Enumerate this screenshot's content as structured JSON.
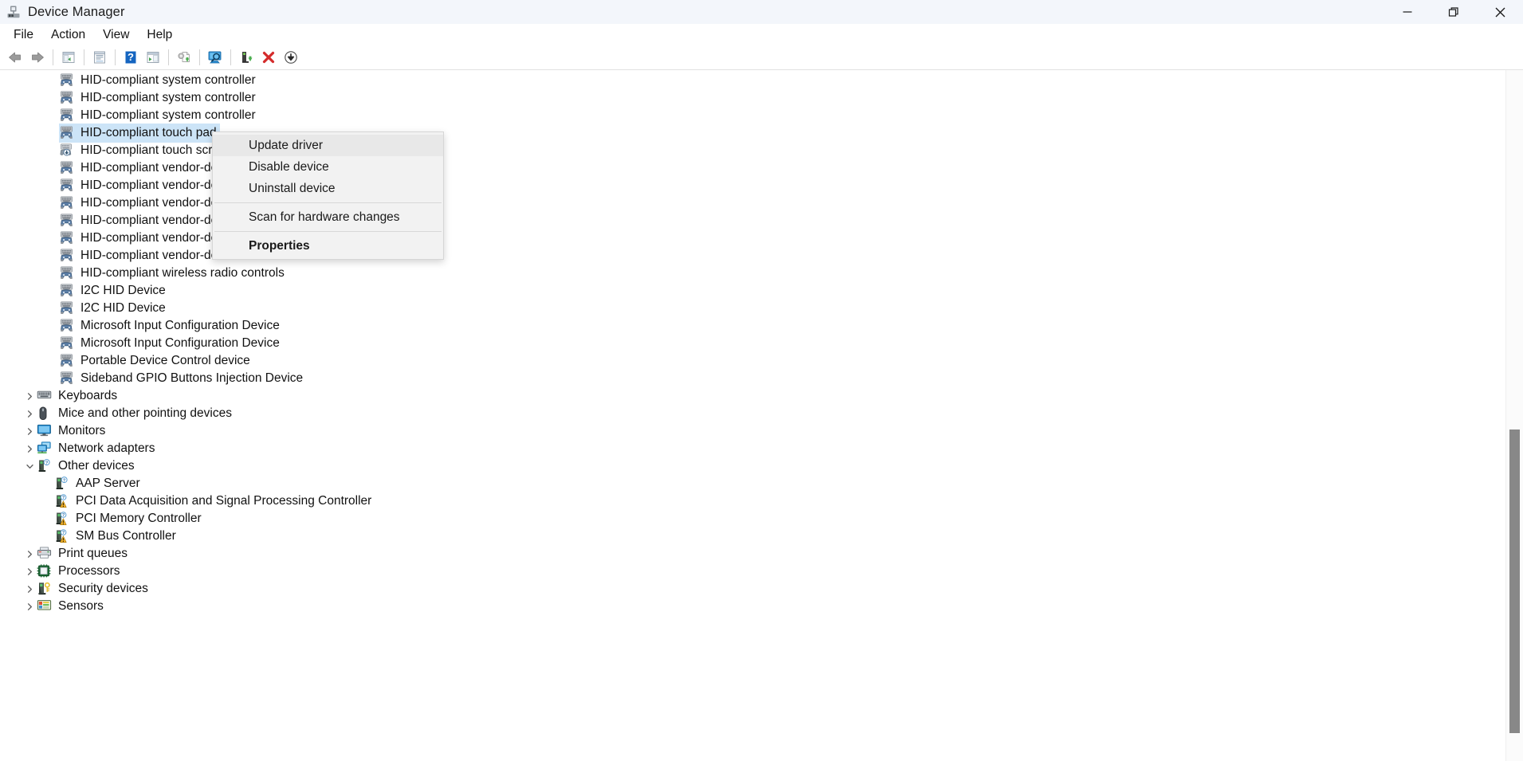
{
  "window": {
    "title": "Device Manager",
    "icon": "device-manager-icon",
    "controls": [
      {
        "name": "minimize",
        "glyph": "minimize-icon"
      },
      {
        "name": "maximize",
        "glyph": "restore-icon"
      },
      {
        "name": "close",
        "glyph": "close-icon"
      }
    ]
  },
  "menubar": {
    "items": [
      {
        "label": "File"
      },
      {
        "label": "Action"
      },
      {
        "label": "View"
      },
      {
        "label": "Help"
      }
    ]
  },
  "toolbar": {
    "buttons": [
      {
        "name": "back-button",
        "icon": "back-arrow-icon"
      },
      {
        "name": "forward-button",
        "icon": "forward-arrow-icon"
      },
      {
        "name": "show-hide-console-tree-button",
        "icon": "console-tree-icon"
      },
      {
        "name": "properties-button",
        "icon": "properties-window-icon"
      },
      {
        "name": "help-button",
        "icon": "help-question-icon"
      },
      {
        "name": "show-hide-action-pane-button",
        "icon": "action-pane-icon"
      },
      {
        "name": "update-driver-button",
        "icon": "update-driver-gear-icon"
      },
      {
        "name": "scan-for-hardware-changes-button",
        "icon": "scan-hardware-monitor-icon"
      },
      {
        "name": "enable-device-button",
        "icon": "enable-device-icon"
      },
      {
        "name": "uninstall-device-button",
        "icon": "uninstall-red-x-icon"
      },
      {
        "name": "add-legacy-hardware-button",
        "icon": "download-arrow-icon"
      }
    ]
  },
  "tree": {
    "rows": [
      {
        "label": "HID-compliant system controller",
        "icon": "hid-device-icon",
        "level": "device",
        "state": "none"
      },
      {
        "label": "HID-compliant system controller",
        "icon": "hid-device-icon",
        "level": "device",
        "state": "none"
      },
      {
        "label": "HID-compliant system controller",
        "icon": "hid-device-icon",
        "level": "device",
        "state": "none"
      },
      {
        "label": "HID-compliant touch pad",
        "icon": "hid-device-icon",
        "level": "device",
        "state": "selected"
      },
      {
        "label": "HID-compliant touch screen",
        "icon": "hid-touchscreen-icon",
        "level": "device",
        "state": "none"
      },
      {
        "label": "HID-compliant vendor-defined device",
        "icon": "hid-device-icon",
        "level": "device",
        "state": "none"
      },
      {
        "label": "HID-compliant vendor-defined device",
        "icon": "hid-device-icon",
        "level": "device",
        "state": "none"
      },
      {
        "label": "HID-compliant vendor-defined device",
        "icon": "hid-device-icon",
        "level": "device",
        "state": "none"
      },
      {
        "label": "HID-compliant vendor-defined device",
        "icon": "hid-device-icon",
        "level": "device",
        "state": "none"
      },
      {
        "label": "HID-compliant vendor-defined device",
        "icon": "hid-device-icon",
        "level": "device",
        "state": "none"
      },
      {
        "label": "HID-compliant vendor-defined device",
        "icon": "hid-device-icon",
        "level": "device",
        "state": "none"
      },
      {
        "label": "HID-compliant wireless radio controls",
        "icon": "hid-device-icon",
        "level": "device",
        "state": "none"
      },
      {
        "label": "I2C HID Device",
        "icon": "hid-device-icon",
        "level": "device",
        "state": "none"
      },
      {
        "label": "I2C HID Device",
        "icon": "hid-device-icon",
        "level": "device",
        "state": "none"
      },
      {
        "label": "Microsoft Input Configuration Device",
        "icon": "hid-device-icon",
        "level": "device",
        "state": "none"
      },
      {
        "label": "Microsoft Input Configuration Device",
        "icon": "hid-device-icon",
        "level": "device",
        "state": "none"
      },
      {
        "label": "Portable Device Control device",
        "icon": "hid-device-icon",
        "level": "device",
        "state": "none"
      },
      {
        "label": "Sideband GPIO Buttons Injection Device",
        "icon": "hid-device-icon",
        "level": "device",
        "state": "none"
      },
      {
        "label": "Keyboards",
        "icon": "keyboard-icon",
        "level": "category",
        "expanded": false
      },
      {
        "label": "Mice and other pointing devices",
        "icon": "mouse-icon",
        "level": "category",
        "expanded": false
      },
      {
        "label": "Monitors",
        "icon": "monitor-icon",
        "level": "category",
        "expanded": false
      },
      {
        "label": "Network adapters",
        "icon": "network-adapter-icon",
        "level": "category",
        "expanded": false
      },
      {
        "label": "Other devices",
        "icon": "unknown-device-icon",
        "level": "category",
        "expanded": true
      },
      {
        "label": "AAP Server",
        "icon": "unknown-device-icon",
        "level": "subdevice",
        "state": "none"
      },
      {
        "label": "PCI Data Acquisition and Signal Processing Controller",
        "icon": "unknown-device-warning-icon",
        "level": "subdevice",
        "state": "none"
      },
      {
        "label": "PCI Memory Controller",
        "icon": "unknown-device-warning-icon",
        "level": "subdevice",
        "state": "none"
      },
      {
        "label": "SM Bus Controller",
        "icon": "unknown-device-warning-icon",
        "level": "subdevice",
        "state": "none"
      },
      {
        "label": "Print queues",
        "icon": "printer-icon",
        "level": "category",
        "expanded": false
      },
      {
        "label": "Processors",
        "icon": "processor-icon",
        "level": "category",
        "expanded": false
      },
      {
        "label": "Security devices",
        "icon": "security-device-icon",
        "level": "category",
        "expanded": false
      },
      {
        "label": "Sensors",
        "icon": "sensor-icon",
        "level": "category",
        "expanded": false
      }
    ]
  },
  "context_menu": {
    "items": [
      {
        "label": "Update driver",
        "highlighted": true,
        "bold": false,
        "separator_after": false
      },
      {
        "label": "Disable device",
        "highlighted": false,
        "bold": false,
        "separator_after": false
      },
      {
        "label": "Uninstall device",
        "highlighted": false,
        "bold": false,
        "separator_after": true
      },
      {
        "label": "Scan for hardware changes",
        "highlighted": false,
        "bold": false,
        "separator_after": true
      },
      {
        "label": "Properties",
        "highlighted": false,
        "bold": true,
        "separator_after": false
      }
    ]
  },
  "scrollbar": {
    "thumb_top_pct": 52,
    "thumb_height_pct": 44
  },
  "colors": {
    "selection": "#cce4f7",
    "titlebar": "#f3f6fb",
    "menu_bg": "#f2f2f2",
    "warning": "#f0b323",
    "accent_blue": "#3a76c4"
  }
}
